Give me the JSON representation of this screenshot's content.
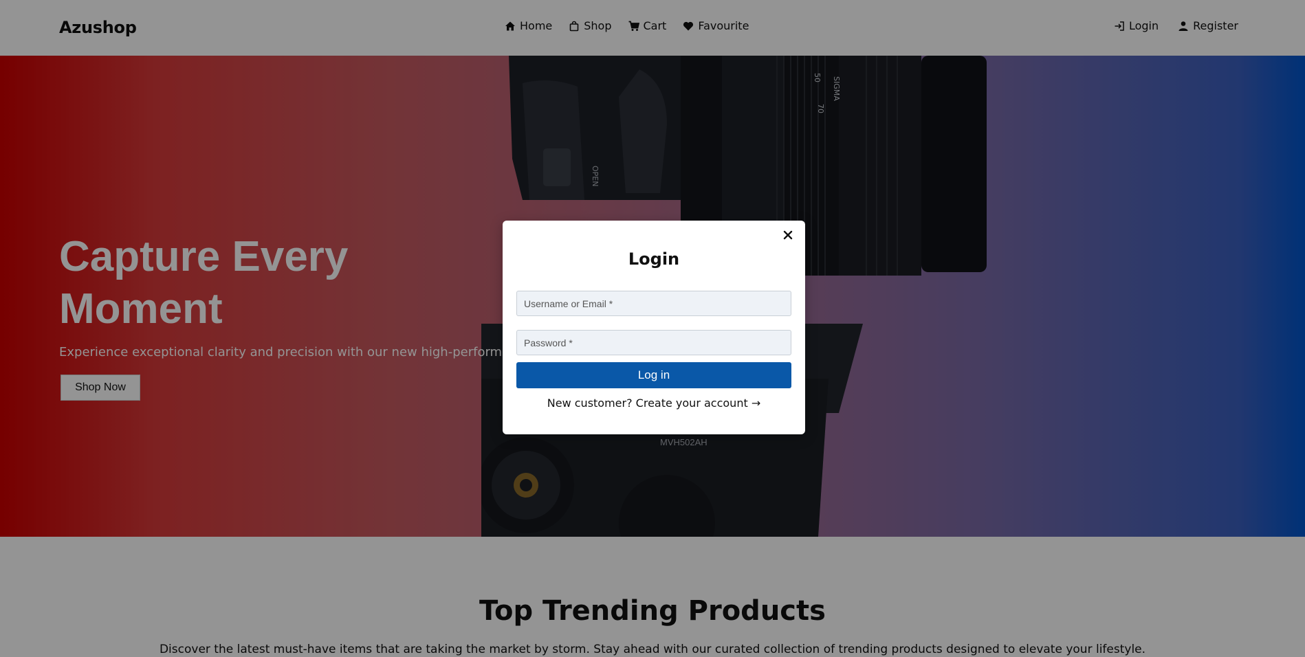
{
  "header": {
    "brand": "Azushop",
    "nav": [
      {
        "label": "Home",
        "icon": "home-icon"
      },
      {
        "label": "Shop",
        "icon": "shopping-bag-icon"
      },
      {
        "label": "Cart",
        "icon": "cart-icon"
      },
      {
        "label": "Favourite",
        "icon": "heart-icon"
      }
    ],
    "auth": [
      {
        "label": "Login",
        "icon": "login-icon"
      },
      {
        "label": "Register",
        "icon": "user-icon"
      }
    ]
  },
  "hero": {
    "title": "Capture Every Moment",
    "subtitle": "Experience exceptional clarity and precision with our new high-performance",
    "button": "Shop Now",
    "camera_model": "MVH502AH",
    "lens_text": "SIGMA",
    "lens_numbers": [
      "50",
      "70"
    ],
    "body_text": "OPEN"
  },
  "section": {
    "title": "Top Trending Products",
    "description": "Discover the latest must-have items that are taking the market by storm. Stay ahead with our curated collection of trending products designed to elevate your lifestyle."
  },
  "modal": {
    "title": "Login",
    "close_label": "×",
    "username_placeholder": "Username or Email *",
    "password_placeholder": "Password *",
    "submit": "Log in",
    "create_account": "New customer? Create your account →"
  },
  "colors": {
    "primary_button": "#0a58a8",
    "hero_left": "#cc0000",
    "hero_right": "#0055cc",
    "overlay": "rgba(0,0,0,0.42)"
  }
}
